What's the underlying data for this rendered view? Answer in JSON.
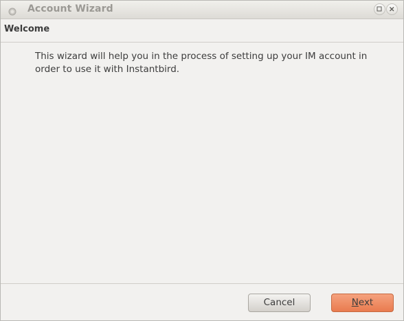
{
  "window": {
    "title": "Account Wizard"
  },
  "page": {
    "title": "Welcome",
    "description": "This wizard will help you in the process of setting up your IM account in order to use it with Instantbird."
  },
  "buttons": {
    "cancel_label": "Cancel",
    "next_accel": "N",
    "next_rest": "ext"
  },
  "colors": {
    "primary_button": "#ee8a5f",
    "window_bg": "#f2f1ef"
  }
}
